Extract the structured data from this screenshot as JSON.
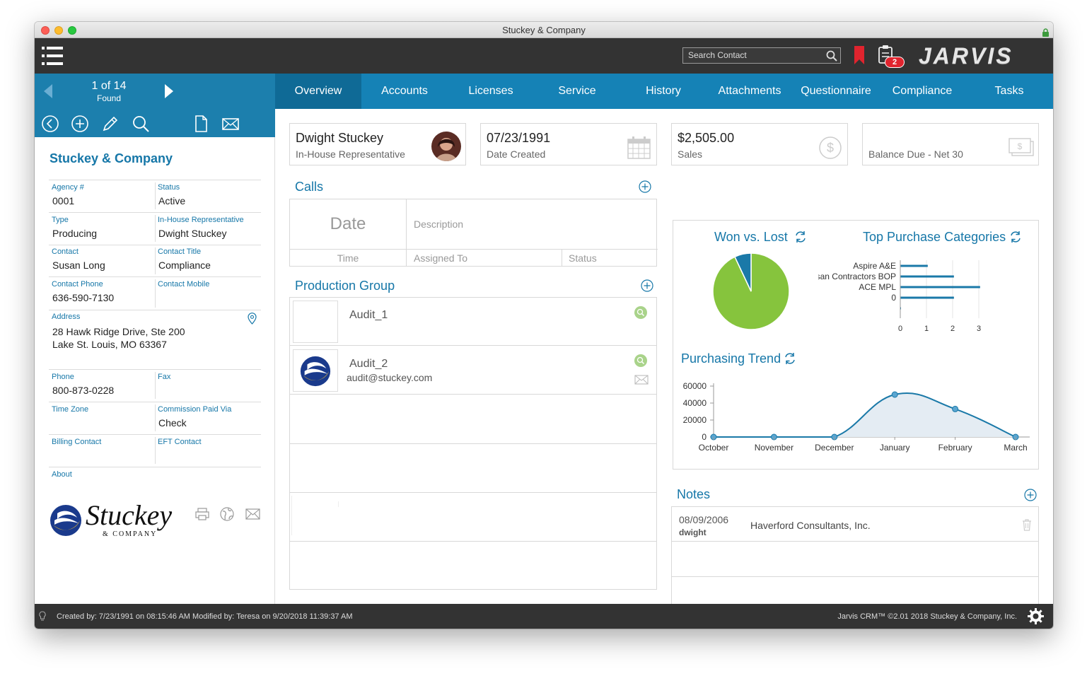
{
  "window": {
    "title": "Stuckey & Company"
  },
  "toolbar": {
    "search_placeholder": "Search Contact",
    "tasks_badge": "2",
    "brand": "JARVIS"
  },
  "record": {
    "position": "1 of 14",
    "found": "Found"
  },
  "tabs": [
    "Overview",
    "Accounts",
    "Licenses",
    "Service",
    "History",
    "Attachments",
    "Questionnaire",
    "Compliance",
    "Tasks"
  ],
  "sidebar": {
    "company_name": "Stuckey & Company",
    "agency_label": "Agency #",
    "agency_value": "0001",
    "status_label": "Status",
    "status_value": "Active",
    "type_label": "Type",
    "type_value": "Producing",
    "inhouse_label": "In-House Representative",
    "inhouse_value": "Dwight Stuckey",
    "contact_label": "Contact",
    "contact_value": "Susan Long",
    "contact_title_label": "Contact Title",
    "contact_title_value": "Compliance",
    "contact_phone_label": "Contact Phone",
    "contact_phone_value": "636-590-7130",
    "contact_mobile_label": "Contact Mobile",
    "contact_mobile_value": "",
    "address_label": "Address",
    "address_line1": "28 Hawk Ridge Drive, Ste 200",
    "address_line2": "Lake St. Louis, MO 63367",
    "phone_label": "Phone",
    "phone_value": "800-873-0228",
    "fax_label": "Fax",
    "fax_value": "",
    "timezone_label": "Time Zone",
    "timezone_value": "",
    "commission_label": "Commission Paid Via",
    "commission_value": "Check",
    "billing_label": "Billing Contact",
    "billing_value": "",
    "eft_label": "EFT Contact",
    "eft_value": "",
    "about_label": "About",
    "logo_text": "Stuckey",
    "logo_sub": "& COMPANY"
  },
  "cards": {
    "rep_name": "Dwight Stuckey",
    "rep_title": "In-House Representative",
    "date_value": "07/23/1991",
    "date_label": "Date Created",
    "sales_value": "$2,505.00",
    "sales_label": "Sales",
    "balance_label": "Balance Due  - Net 30"
  },
  "calls": {
    "title": "Calls",
    "date_col": "Date",
    "description_col": "Description",
    "time_col": "Time",
    "assigned_col": "Assigned To",
    "status_col": "Status"
  },
  "production": {
    "title": "Production Group",
    "items": [
      {
        "name": "Audit_1",
        "email": ""
      },
      {
        "name": "Audit_2",
        "email": "audit@stuckey.com"
      }
    ]
  },
  "charts_panel": {
    "won_lost_title": "Won vs. Lost",
    "top_cat_title": "Top Purchase Categories",
    "trend_title": "Purchasing Trend"
  },
  "chart_data": [
    {
      "type": "pie",
      "title": "Won vs. Lost",
      "values": [
        0.93,
        0.07
      ],
      "colors": [
        "#86c43d",
        "#1a79a8"
      ]
    },
    {
      "type": "bar",
      "orientation": "horizontal",
      "title": "Top Purchase Categories",
      "categories": [
        "Aspire A&E",
        "Artisan Contractors BOP",
        "ACE MPL",
        "0",
        ""
      ],
      "values": [
        1.05,
        2.05,
        3.05,
        2.05,
        0.02
      ],
      "xlim": [
        0,
        3
      ],
      "xticks": [
        "0",
        "1",
        "2",
        "3"
      ],
      "color": "#1a79a8"
    },
    {
      "type": "area",
      "title": "Purchasing Trend",
      "categories": [
        "October",
        "November",
        "December",
        "January",
        "February",
        "March"
      ],
      "values": [
        0,
        0,
        0,
        50000,
        33000,
        0
      ],
      "ylim": [
        0,
        60000
      ],
      "yticks": [
        "0",
        "20000",
        "40000",
        "60000"
      ],
      "color": "#1a79a8",
      "fill": "#e4ecf3"
    }
  ],
  "notes": {
    "title": "Notes",
    "items": [
      {
        "date": "08/09/2006",
        "user": "dwight",
        "text": "Haverford Consultants, Inc."
      }
    ]
  },
  "footer": {
    "left": "Created by: 7/23/1991 on 08:15:46 AM Modified by: Teresa on 9/20/2018 11:39:37 AM",
    "right": "Jarvis CRM™ ©2.01 2018 Stuckey & Company, Inc."
  }
}
